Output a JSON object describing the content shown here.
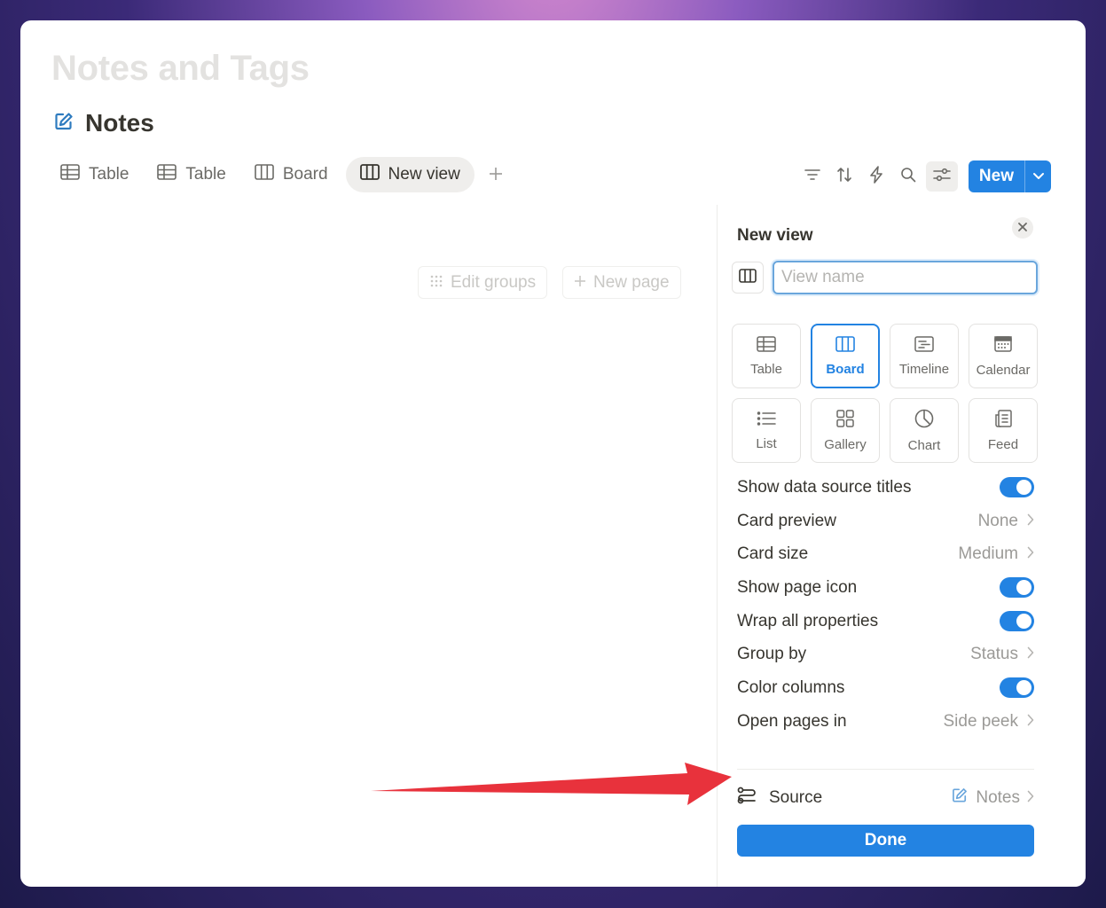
{
  "page": {
    "title": "Notes and Tags"
  },
  "database": {
    "title": "Notes",
    "icon": "edit-note-icon"
  },
  "tabs": [
    {
      "label": "Table",
      "icon": "table-icon"
    },
    {
      "label": "Table",
      "icon": "table-icon"
    },
    {
      "label": "Board",
      "icon": "board-icon"
    },
    {
      "label": "New view",
      "icon": "board-icon",
      "active": true
    }
  ],
  "toolbar": {
    "icons": [
      "filter-icon",
      "sort-icon",
      "automation-icon",
      "search-icon",
      "settings-icon"
    ],
    "new_label": "New"
  },
  "board": {
    "edit_groups": "Edit groups",
    "new_page": "New page"
  },
  "panel": {
    "title": "New view",
    "name_placeholder": "View name",
    "layouts": [
      {
        "label": "Table",
        "icon": "table-icon"
      },
      {
        "label": "Board",
        "icon": "board-icon",
        "selected": true
      },
      {
        "label": "Timeline",
        "icon": "timeline-icon"
      },
      {
        "label": "Calendar",
        "icon": "calendar-icon"
      },
      {
        "label": "List",
        "icon": "list-icon"
      },
      {
        "label": "Gallery",
        "icon": "gallery-icon"
      },
      {
        "label": "Chart",
        "icon": "chart-icon"
      },
      {
        "label": "Feed",
        "icon": "feed-icon"
      }
    ],
    "settings": [
      {
        "label": "Show data source titles",
        "toggle": true
      },
      {
        "label": "Card preview",
        "value": "None"
      },
      {
        "label": "Card size",
        "value": "Medium"
      },
      {
        "label": "Show page icon",
        "toggle": true
      },
      {
        "label": "Wrap all properties",
        "toggle": true
      },
      {
        "label": "Group by",
        "value": "Status"
      },
      {
        "label": "Color columns",
        "toggle": true
      },
      {
        "label": "Open pages in",
        "value": "Side peek"
      }
    ],
    "source": {
      "label": "Source",
      "value": "Notes"
    },
    "done_label": "Done"
  },
  "colors": {
    "accent": "#2383e2",
    "arrow": "#e8323c"
  }
}
